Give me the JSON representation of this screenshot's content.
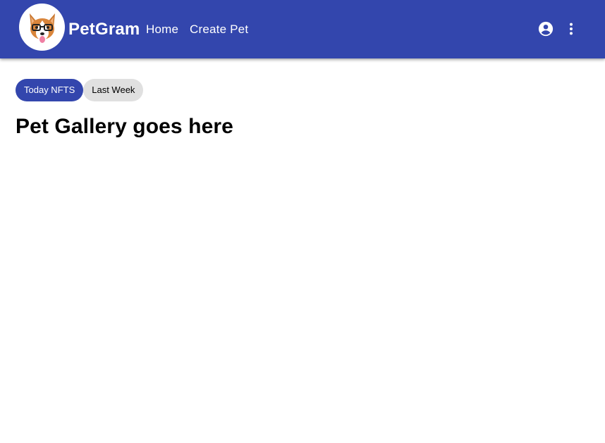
{
  "appbar": {
    "brand": "PetGram",
    "logo_icon": "corgi-with-glasses-logo",
    "nav": {
      "home": "Home",
      "create_pet": "Create Pet"
    },
    "account_icon": "account-circle-icon",
    "more_icon": "more-vert-icon",
    "color": "#3346ad"
  },
  "filters": {
    "today": "Today NFTS",
    "last_week": "Last Week",
    "selected": "Today NFTS"
  },
  "main": {
    "heading": "Pet Gallery goes here"
  }
}
